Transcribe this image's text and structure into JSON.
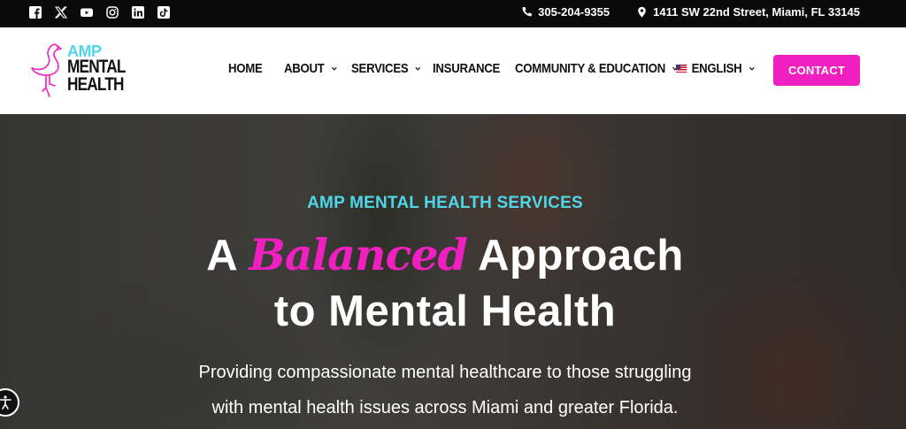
{
  "topbar": {
    "social": [
      {
        "name": "facebook-icon"
      },
      {
        "name": "x-icon"
      },
      {
        "name": "youtube-icon"
      },
      {
        "name": "instagram-icon"
      },
      {
        "name": "linkedin-icon"
      },
      {
        "name": "tiktok-icon"
      }
    ],
    "phone": "305-204-9355",
    "address": "1411 SW 22nd Street, Miami, FL 33145"
  },
  "logo": {
    "line1": "AMP",
    "line2": "MENTAL",
    "line3": "HEALTH"
  },
  "nav": {
    "items": [
      {
        "label": "HOME",
        "has_dropdown": false
      },
      {
        "label": "ABOUT",
        "has_dropdown": true
      },
      {
        "label": "SERVICES",
        "has_dropdown": true
      },
      {
        "label": "INSURANCE",
        "has_dropdown": false
      },
      {
        "label": "COMMUNITY & EDUCATION",
        "has_dropdown": true
      }
    ],
    "language": "ENGLISH",
    "contact_label": "CONTACT"
  },
  "hero": {
    "eyebrow": "AMP MENTAL HEALTH SERVICES",
    "title_before": "A ",
    "title_accent": "Balanced",
    "title_after": " Approach",
    "title_line2": "to Mental Health",
    "subtitle_line1": "Providing compassionate mental healthcare to those struggling",
    "subtitle_line2": "with mental health issues across Miami and greater Florida."
  },
  "colors": {
    "accent_pink": "#f01fc0",
    "accent_cyan": "#4fd6e8",
    "topbar_bg": "#0a0a0a"
  }
}
